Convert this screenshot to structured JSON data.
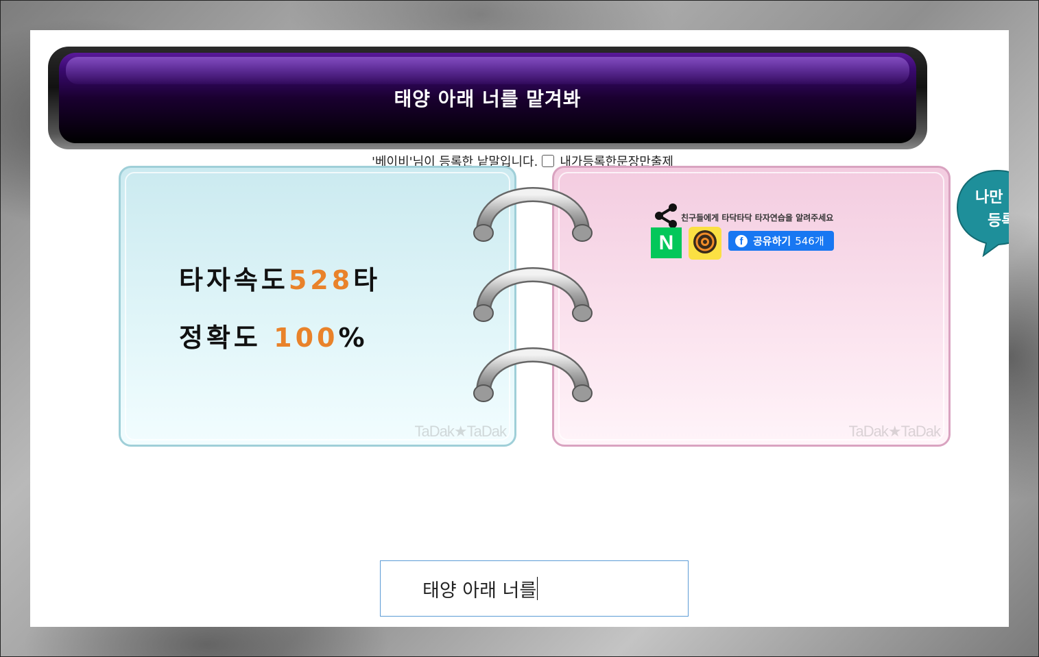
{
  "title": "태양 아래 너를 맡겨봐",
  "registration": {
    "text": "'베이비'님이 등록한 낱말입니다.",
    "checkbox_label": "내가등록한문장만출제",
    "checked": false
  },
  "stats": {
    "speed_label": "타자속도",
    "speed_value": "528",
    "speed_unit": "타",
    "accuracy_label": "정확도",
    "accuracy_value": "100",
    "accuracy_unit": "%"
  },
  "watermark": "TaDak★TaDak",
  "share": {
    "text": "친구들에게 타닥타닥 타자연습을 알려주세요",
    "naver_letter": "N",
    "facebook_label": "공유하기",
    "facebook_count": "546개"
  },
  "bubble": {
    "line1": "나만",
    "line2": "등록"
  },
  "input": {
    "value": "태양 아래 너를"
  },
  "colors": {
    "title_bg": "#1a0030",
    "stat_number": "#e9822a",
    "left_page": "#cbeaf0",
    "right_page": "#f3cce0",
    "naver": "#03c75a",
    "kakao": "#fbe043",
    "facebook": "#1877f2",
    "bubble": "#1e8f9a"
  }
}
